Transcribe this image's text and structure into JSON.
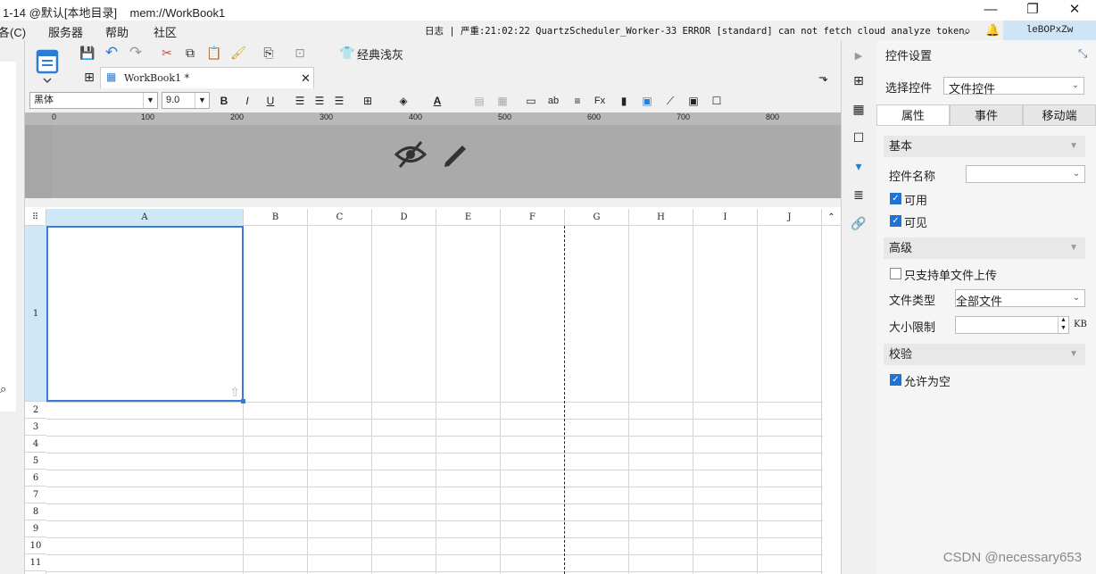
{
  "title_bar": {
    "title": "1-14 @默认[本地目录]    mem://WorkBook1",
    "minimize": "—",
    "restore": "❐",
    "close": "✕"
  },
  "menu": {
    "items": [
      "各(C)",
      "服务器",
      "帮助",
      "社区"
    ]
  },
  "log_text": "日志 | 严重:21:02:22 QuartzScheduler_Worker-33 ERROR [standard] can not fetch cloud analyze token.",
  "user": "leBOPxZw",
  "toolbar": {
    "theme_label": "经典浅灰"
  },
  "tab": {
    "label": "WorkBook1 *",
    "close": "✕"
  },
  "format": {
    "font": "黑体",
    "size": "9.0",
    "bold": "B",
    "italic": "I",
    "underline": "U"
  },
  "ruler": {
    "ticks": [
      "0",
      "100",
      "200",
      "300",
      "400",
      "500",
      "600",
      "700",
      "800"
    ]
  },
  "sheet": {
    "columns": [
      "A",
      "B",
      "C",
      "D",
      "E",
      "F",
      "G",
      "H",
      "I",
      "J"
    ],
    "rows": [
      "1",
      "2",
      "3",
      "4",
      "5",
      "6",
      "7",
      "8",
      "9",
      "10",
      "11"
    ]
  },
  "panel": {
    "title": "控件设置",
    "select_label": "选择控件",
    "select_value": "文件控件",
    "tabs": [
      "属性",
      "事件",
      "移动端"
    ],
    "basic_header": "基本",
    "name_label": "控件名称",
    "name_value": "",
    "enabled_label": "可用",
    "visible_label": "可见",
    "advanced_header": "高级",
    "single_upload_label": "只支持单文件上传",
    "file_type_label": "文件类型",
    "file_type_value": "全部文件",
    "size_limit_label": "大小限制",
    "size_unit": "KB",
    "validate_header": "校验",
    "allow_empty_label": "允许为空"
  },
  "watermark": "CSDN @necessary653"
}
